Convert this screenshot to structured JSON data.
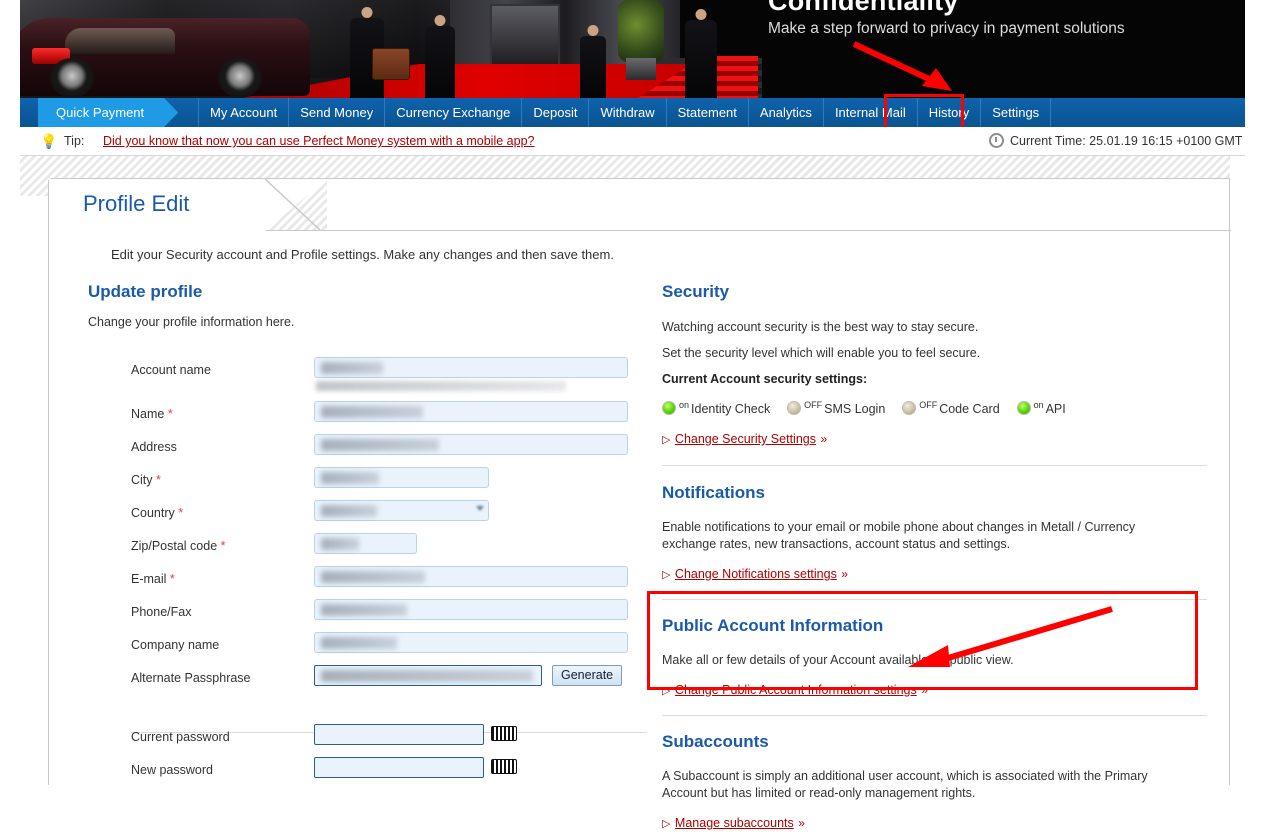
{
  "banner": {
    "title": "Confidentiality",
    "subtitle": "Make a step forward to privacy in payment solutions"
  },
  "nav": {
    "quick_payment": "Quick Payment",
    "items": [
      "My Account",
      "Send Money",
      "Currency Exchange",
      "Deposit",
      "Withdraw",
      "Statement",
      "Analytics",
      "Internal Mail",
      "History",
      "Settings"
    ]
  },
  "tipbar": {
    "icon": "lightbulb-icon",
    "label": "Tip:",
    "link": "Did you know that now you can use Perfect Money system with a mobile app?",
    "clock_icon": "clock-icon",
    "current_time": "Current Time: 25.01.19 16:15 +0100 GMT"
  },
  "page": {
    "tab_title": "Profile Edit",
    "intro": "Edit your Security account and Profile settings. Make any changes and then save them."
  },
  "update_profile": {
    "title": "Update profile",
    "desc": "Change your profile information here.",
    "fields": [
      {
        "label": "Account name",
        "required": false,
        "value": "",
        "redacted": true,
        "width": "wide",
        "hint": true
      },
      {
        "label": "Name",
        "required": true,
        "value": "",
        "redacted": true,
        "width": "wide"
      },
      {
        "label": "Address",
        "required": false,
        "value": "",
        "redacted": true,
        "width": "wide"
      },
      {
        "label": "City",
        "required": true,
        "value": "",
        "redacted": true,
        "width": "mid"
      },
      {
        "label": "Country",
        "required": true,
        "value": "",
        "redacted": true,
        "width": "mid",
        "select": true
      },
      {
        "label": "Zip/Postal code",
        "required": true,
        "value": "",
        "redacted": true,
        "width": "narrow"
      },
      {
        "label": "E-mail",
        "required": true,
        "value": "",
        "redacted": true,
        "width": "wide"
      },
      {
        "label": "Phone/Fax",
        "required": false,
        "value": "",
        "redacted": true,
        "width": "wide"
      },
      {
        "label": "Company name",
        "required": false,
        "value": "",
        "redacted": true,
        "width": "wide"
      }
    ],
    "passphrase_label": "Alternate Passphrase",
    "passphrase_value": "",
    "generate_label": "Generate",
    "current_password_label": "Current password",
    "current_password_value": "",
    "new_password_label": "New password",
    "new_password_value": "",
    "keyboard_icon": "virtual-keyboard-icon"
  },
  "security": {
    "title": "Security",
    "line1": "Watching account security is the best way to stay secure.",
    "line2": "Set the security level which will enable you to feel secure.",
    "settings_heading": "Current Account security settings:",
    "toggles": [
      {
        "label": "Identity Check",
        "state": "on"
      },
      {
        "label": "SMS Login",
        "state": "OFF"
      },
      {
        "label": "Code Card",
        "state": "OFF"
      },
      {
        "label": "API",
        "state": "on"
      }
    ],
    "link": "Change Security Settings",
    "link_suffix": "»"
  },
  "notifications": {
    "title": "Notifications",
    "desc": "Enable notifications to your email or mobile phone about changes in Metall / Currency exchange rates, new transactions, account status and settings.",
    "link": "Change Notifications settings",
    "link_suffix": "»"
  },
  "public_account_information": {
    "title": "Public Account Information",
    "desc": "Make all or few details of your Account available for public view.",
    "link": "Change Public Account Information settings",
    "link_suffix": "»"
  },
  "subaccounts": {
    "title": "Subaccounts",
    "desc": "A Subaccount is simply an additional user account, which is associated with the Primary Account but has limited or read-only management rights.",
    "link": "Manage subaccounts",
    "link_suffix": "»"
  },
  "annotations": {
    "highlight_color": "#ff0000",
    "arrow_to_settings": "red-arrow-pointing-to-settings-tab",
    "arrow_to_public_account": "red-arrow-pointing-to-public-account-information-link"
  },
  "colors": {
    "nav_blue": "#0f62ad",
    "quick_payment_blue": "#1e9be4",
    "heading_blue": "#1a5aa8",
    "link_red": "#b00000",
    "required_red": "#e8413c",
    "highlight_red": "#ff0000",
    "led_on": "#66dd11",
    "led_off": "#cfc6ae"
  }
}
